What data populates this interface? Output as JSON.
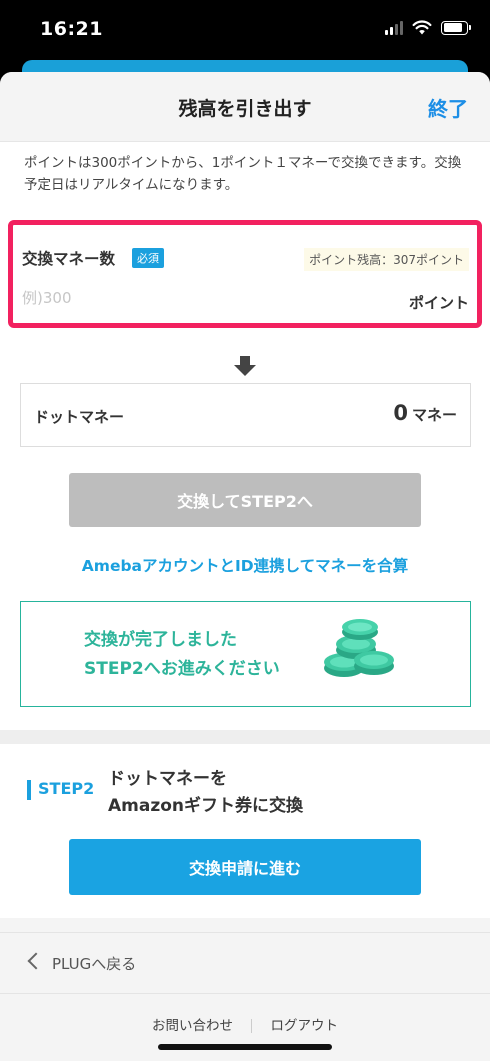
{
  "status_bar": {
    "time": "16:21"
  },
  "nav": {
    "title": "残高を引き出す",
    "done_label": "終了"
  },
  "intro_text": "ポイントは300ポイントから、1ポイント１マネーで交換できます。交換予定日はリアルタイムになります。",
  "exchange_input": {
    "label": "交換マネー数",
    "required_badge": "必須",
    "balance_text": "ポイント残高：307ポイント",
    "placeholder": "例)300",
    "value": "",
    "unit": "ポイント"
  },
  "money_display": {
    "label": "ドットマネー",
    "value": "0",
    "unit": "マネー"
  },
  "step2_button_label": "交換してSTEP2へ",
  "link_text": "AmebaアカウントとID連携してマネーを合算",
  "completion": {
    "line1": "交換が完了しました",
    "line2": "STEP2へお進みください"
  },
  "step2": {
    "tag": "STEP2",
    "desc_line1": "ドットマネーを",
    "desc_line2": "Amazonギフト券に交換",
    "button_label": "交換申請に進む"
  },
  "back_link": "PLUGへ戻る",
  "footer": {
    "contact": "お問い合わせ",
    "logout": "ログアウト"
  },
  "colors": {
    "accent_blue": "#1ba0de",
    "highlight_border": "#f2215f",
    "success_green": "#2db49a",
    "disabled_gray": "#bdbdbd"
  }
}
